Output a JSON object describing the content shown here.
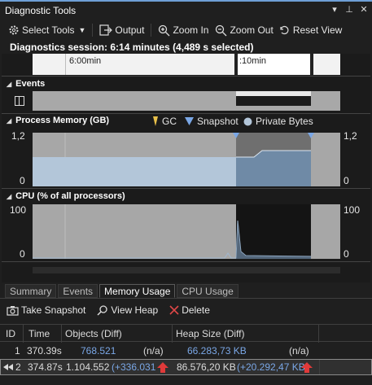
{
  "window": {
    "title": "Diagnostic Tools",
    "dropdown_icon": "chevron-down-icon",
    "pin_icon": "pin-icon",
    "close_icon": "close-icon"
  },
  "toolbar": {
    "select_tools": "Select Tools",
    "output": "Output",
    "zoom_in": "Zoom In",
    "zoom_out": "Zoom Out",
    "reset_view": "Reset View"
  },
  "session": {
    "text": "Diagnostics session: 6:14 minutes (4,489 s selected)"
  },
  "ruler": {
    "label_left": "6:00min",
    "label_right": ":10min"
  },
  "events": {
    "header": "Events"
  },
  "memory": {
    "header": "Process Memory (GB)",
    "legend": {
      "gc": "GC",
      "snapshot": "Snapshot",
      "private_bytes": "Private Bytes"
    },
    "y_max_left": "1,2",
    "y_min_left": "0",
    "y_max_right": "1,2",
    "y_min_right": "0"
  },
  "cpu": {
    "header": "CPU (% of all processors)",
    "y_max_left": "100",
    "y_min_left": "0",
    "y_max_right": "100",
    "y_min_right": "0"
  },
  "tabs": [
    "Summary",
    "Events",
    "Memory Usage",
    "CPU Usage"
  ],
  "active_tab": "Memory Usage",
  "memory_toolbar": {
    "take_snapshot": "Take Snapshot",
    "view_heap": "View Heap",
    "delete": "Delete"
  },
  "grid": {
    "columns": [
      "ID",
      "Time",
      "Objects (Diff)",
      "Heap Size (Diff)"
    ],
    "rows": [
      {
        "id": "1",
        "time": "370.39s",
        "objects": "768.521",
        "objects_diff": "(n/a)",
        "heap": "66.283,73 KB",
        "heap_diff": "(n/a)"
      },
      {
        "id": "2",
        "time": "374.87s",
        "objects": "1.104.552",
        "objects_diff": "(+336.031",
        "heap": "86.576,20 KB",
        "heap_diff": "(+20.292,47 KB"
      }
    ]
  },
  "colors": {
    "accent": "#6e9fd6",
    "plot_bg": "#a7a7a7",
    "memory_fill": "#b3c6d9",
    "link_blue": "#7aa7e6",
    "arrow_red": "#e03a3a",
    "gc_yellow": "#e8c04a"
  }
}
